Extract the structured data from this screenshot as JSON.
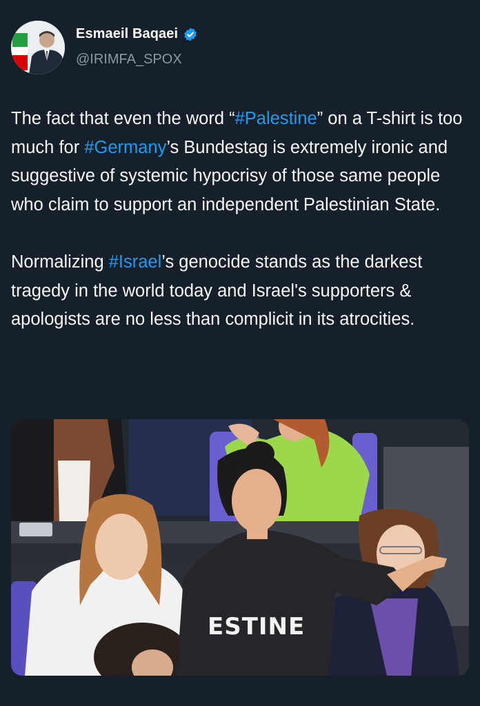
{
  "author": {
    "display_name": "Esmaeil Baqaei",
    "handle": "@IRIMFA_SPOX",
    "verified": true,
    "verified_color": "#1d9bf0"
  },
  "tweet": {
    "p1_pre": "The fact that even the word “",
    "p1_tag1": "#Palestine",
    "p1_mid1": "” on a T-shirt is too much for ",
    "p1_tag2": "#Germany",
    "p1_post": "’s Bundestag is extremely ironic and suggestive of systemic hypocrisy of those same people who claim to support an independent Palestinian State.",
    "p2_pre": "Normalizing ",
    "p2_tag": "#Israel",
    "p2_post": "’s genocide stands as the darkest tragedy in the world today and Israel's supporters & apologists are no less than complicit in its atrocities."
  },
  "media": {
    "shirt_text": "ESTINE"
  },
  "colors": {
    "background": "#15202b",
    "text": "#f7f9f9",
    "secondary_text": "#8b98a5",
    "hashtag": "#1d9bf0"
  }
}
